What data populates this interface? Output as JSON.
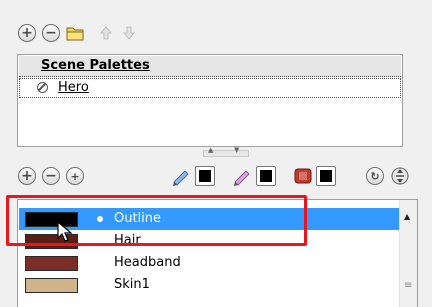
{
  "scene_palettes": {
    "header": "Scene Palettes",
    "items": [
      {
        "label": "Hero"
      }
    ]
  },
  "colors": [
    {
      "name": "Outline",
      "hex": "#000000",
      "selected": true
    },
    {
      "name": "Hair",
      "hex": "#5a1e16",
      "selected": false
    },
    {
      "name": "Headband",
      "hex": "#7a2e26",
      "selected": false
    },
    {
      "name": "Skin1",
      "hex": "#d2b48c",
      "selected": false
    }
  ],
  "accent": {
    "selection": "#3399ff",
    "highlight": "#e8171d"
  },
  "icons": {
    "top_toolbar": [
      "add-icon",
      "remove-icon",
      "folder-icon",
      "move-up-icon",
      "move-down-icon"
    ],
    "color_toolbar": [
      "add-icon",
      "remove-icon",
      "duplicate-icon",
      "line-color-pencil-icon",
      "fill-pencil-icon",
      "colour-swatch-icon",
      "refresh-icon",
      "sort-icon"
    ]
  }
}
